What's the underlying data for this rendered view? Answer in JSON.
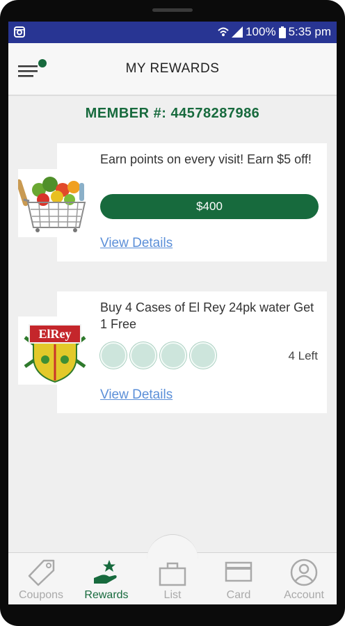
{
  "status": {
    "signal_text": "100%",
    "time": "5:35 pm"
  },
  "header": {
    "title": "MY REWARDS"
  },
  "member": {
    "label": "MEMBER #: 44578287986"
  },
  "rewards": [
    {
      "description": "Earn points on every visit! Earn $5 off!",
      "progress_label": "$400",
      "link": "View Details",
      "image": "grocery-basket"
    },
    {
      "description": "Buy 4 Cases of El Rey 24pk water Get 1 Free",
      "punches_total": 4,
      "punches_filled": 0,
      "remaining": "4 Left",
      "link": "View Details",
      "image": "el-rey-logo",
      "logo_text": "ElRey"
    }
  ],
  "tabs": [
    {
      "label": "Coupons",
      "icon": "tag-icon"
    },
    {
      "label": "Rewards",
      "icon": "rewards-icon",
      "active": true
    },
    {
      "label": "List",
      "icon": "bag-icon"
    },
    {
      "label": "Card",
      "icon": "card-icon"
    },
    {
      "label": "Account",
      "icon": "account-icon"
    }
  ],
  "colors": {
    "statusbar": "#283593",
    "brand": "#176a3d",
    "link": "#5b8fd8",
    "punch": "#cde5dc"
  }
}
